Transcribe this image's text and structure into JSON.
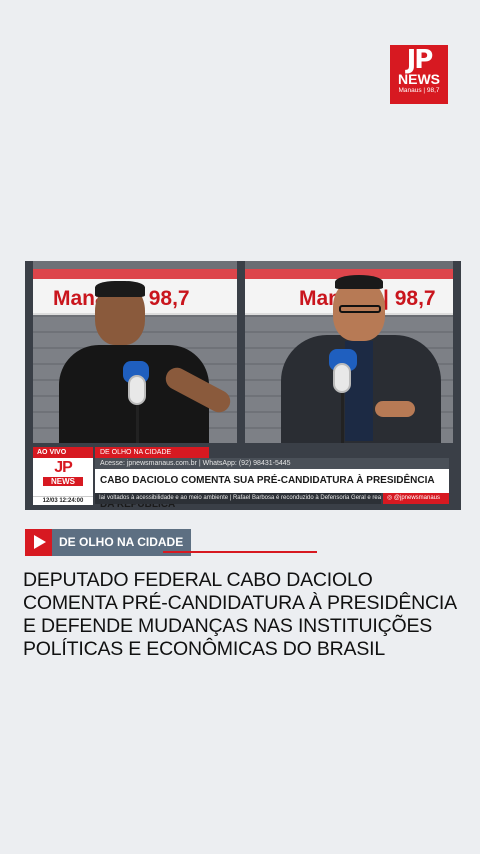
{
  "logo": {
    "mark": "JP",
    "name": "NEWS",
    "city": "Manaus | 98,7"
  },
  "video": {
    "studio_sign_left": "Manaus | 98,7",
    "studio_sign_right": "Manaus | 98,7",
    "lower_third": {
      "badge": "AO VIVO",
      "mini_logo_mark": "JP",
      "mini_logo_name": "NEWS",
      "time": "12/03 12:24:00",
      "kicker": "DE OLHO NA CIDADE",
      "site": "Acesse: jpnewsmanaus.com.br | WhatsApp: (92) 98431-5445",
      "headline": "CABO DACIOLO COMENTA SUA PRÉ-CANDIDATURA À PRESIDÊNCIA DA REPÚBLICA",
      "ticker": "Iai voltados à acessibilidade e ao meio ambiente | Rafael Barbosa é reconduzido à Defensoria Geral e reassu",
      "social": "@jpnewsmanaus"
    }
  },
  "section_tag": {
    "label": "DE OLHO NA CIDADE",
    "icon": "play-icon"
  },
  "article": {
    "title": "DEPUTADO FEDERAL CABO DACIOLO COMENTA PRÉ-CANDIDATURA À PRESIDÊNCIA E DEFENDE MUDANÇAS NAS INSTITUIÇÕES POLÍTICAS E ECONÔMICAS DO BRASIL"
  },
  "colors": {
    "brand_red": "#d71921",
    "tag_slate": "#5d6f82",
    "background": "#eceef1"
  }
}
